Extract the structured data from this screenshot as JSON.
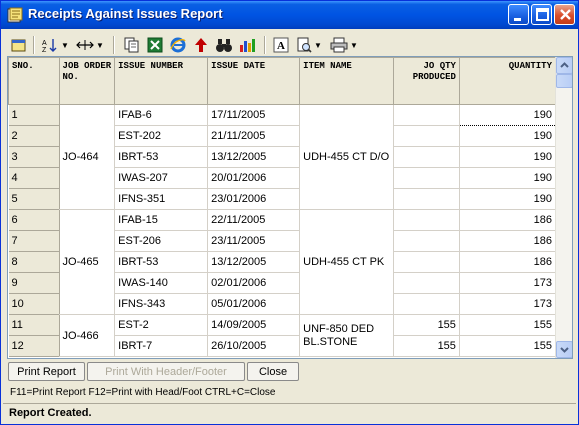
{
  "window": {
    "title": "Receipts Against Issues Report"
  },
  "grid": {
    "columns": [
      "SNO.",
      "JOB ORDER NO.",
      "ISSUE NUMBER",
      "ISSUE DATE",
      "ITEM NAME",
      "JO QTY PRODUCED",
      "QUANTITY"
    ],
    "rows": [
      {
        "sno": "1",
        "issue_number": "IFAB-6",
        "issue_date": "17/11/2005",
        "jo_qty": "",
        "quantity": "190"
      },
      {
        "sno": "2",
        "issue_number": "EST-202",
        "issue_date": "21/11/2005",
        "jo_qty": "",
        "quantity": "190"
      },
      {
        "sno": "3",
        "issue_number": "IBRT-53",
        "issue_date": "13/12/2005",
        "jo_qty": "",
        "quantity": "190"
      },
      {
        "sno": "4",
        "issue_number": "IWAS-207",
        "issue_date": "20/01/2006",
        "jo_qty": "",
        "quantity": "190"
      },
      {
        "sno": "5",
        "issue_number": "IFNS-351",
        "issue_date": "23/01/2006",
        "jo_qty": "",
        "quantity": "190"
      },
      {
        "sno": "6",
        "issue_number": "IFAB-15",
        "issue_date": "22/11/2005",
        "jo_qty": "",
        "quantity": "186"
      },
      {
        "sno": "7",
        "issue_number": "EST-206",
        "issue_date": "23/11/2005",
        "jo_qty": "",
        "quantity": "186"
      },
      {
        "sno": "8",
        "issue_number": "IBRT-53",
        "issue_date": "13/12/2005",
        "jo_qty": "",
        "quantity": "186"
      },
      {
        "sno": "9",
        "issue_number": "IWAS-140",
        "issue_date": "02/01/2006",
        "jo_qty": "",
        "quantity": "173"
      },
      {
        "sno": "10",
        "issue_number": "IFNS-343",
        "issue_date": "05/01/2006",
        "jo_qty": "",
        "quantity": "173"
      },
      {
        "sno": "11",
        "issue_number": "EST-2",
        "issue_date": "14/09/2005",
        "jo_qty": "155",
        "quantity": "155"
      },
      {
        "sno": "12",
        "issue_number": "IBRT-7",
        "issue_date": "26/10/2005",
        "jo_qty": "155",
        "quantity": "155"
      }
    ],
    "groups": [
      {
        "job_order": "JO-464",
        "item_name": "UDH-455 CT D/O"
      },
      {
        "job_order": "JO-465",
        "item_name": "UDH-455 CT PK"
      },
      {
        "job_order": "JO-466",
        "item_name": "UNF-850 DED BL.STONE"
      }
    ]
  },
  "buttons": {
    "print_report": "Print Report",
    "print_header_footer": "Print With Header/Footer",
    "close": "Close"
  },
  "hint": "F11=Print Report  F12=Print with Head/Foot  CTRL+C=Close",
  "status": "Report Created."
}
